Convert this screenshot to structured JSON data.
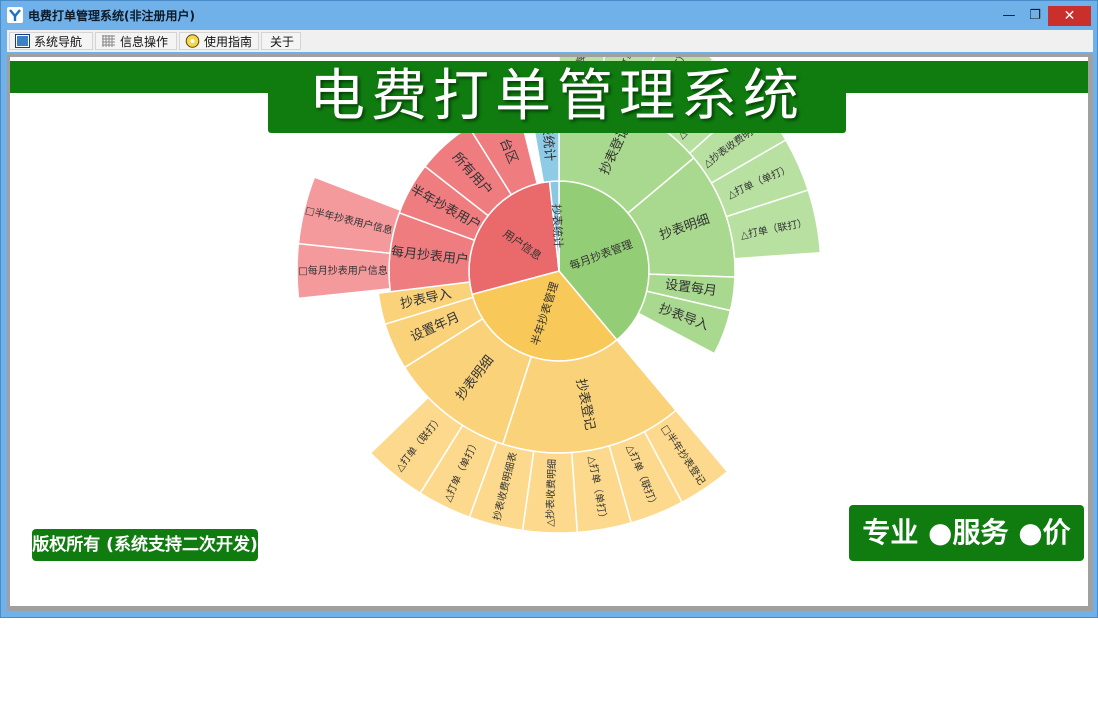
{
  "window": {
    "title": "电费打单管理系统(非注册用户)",
    "controls": {
      "minimize": "—",
      "maximize": "❐",
      "close": "✕"
    }
  },
  "menu": [
    {
      "label": "系统导航",
      "icon": "navigator-icon"
    },
    {
      "label": "信息操作",
      "icon": "grid-icon"
    },
    {
      "label": "使用指南",
      "icon": "guide-icon"
    },
    {
      "label": "关于",
      "icon": ""
    }
  ],
  "banner": {
    "title": "电费打单管理系统"
  },
  "footer": {
    "copyright": "版权所有 (系统支持二次开发)",
    "slogan": "专业 ●服务 ●价值"
  },
  "colors": {
    "green_brand": "#107c10",
    "green_segment": "#a3d88a",
    "red_segment": "#ee6b6e",
    "blue_segment": "#88c8e3",
    "yellow_segment": "#f7cf6a"
  },
  "sunburst": {
    "inner": [
      {
        "label": "每月抄表管理",
        "color": "#93cd75"
      },
      {
        "label": "半年抄表管理",
        "color": "#f8c859"
      },
      {
        "label": "用户信息",
        "color": "#ea6a6c"
      },
      {
        "label": "抄表统计",
        "color": "#88c8e3"
      }
    ],
    "middle": [
      {
        "label": "抄表登记",
        "color": "#a8d98e"
      },
      {
        "label": "抄表明细",
        "color": "#a8d98e"
      },
      {
        "label": "设置每月",
        "color": "#a8d98e"
      },
      {
        "label": "抄表导入",
        "color": "#a8d98e"
      },
      {
        "label": "抄表登记",
        "color": "#fad27a"
      },
      {
        "label": "抄表明细",
        "color": "#fad27a"
      },
      {
        "label": "设置年月",
        "color": "#fad27a"
      },
      {
        "label": "抄表导入",
        "color": "#fad27a"
      },
      {
        "label": "每月抄表用户",
        "color": "#ef7d80"
      },
      {
        "label": "半年抄表用户",
        "color": "#ef7d80"
      },
      {
        "label": "所有用户",
        "color": "#ef7d80"
      },
      {
        "label": "台区",
        "color": "#ef7d80"
      },
      {
        "label": "抄表统计",
        "color": "#8fcbe5"
      }
    ],
    "outer": [
      {
        "label": "□每月登",
        "color": "#b7e0a1"
      },
      {
        "label": "△打单",
        "color": "#b7e0a1"
      },
      {
        "label": "△打单（单打）",
        "color": "#b7e0a1"
      },
      {
        "label": "△抄表收费明细表",
        "color": "#b7e0a1"
      },
      {
        "label": "△抄表收费明细表",
        "color": "#b7e0a1"
      },
      {
        "label": "△打单（单打）",
        "color": "#b7e0a1"
      },
      {
        "label": "△打单（联打）",
        "color": "#b7e0a1"
      },
      {
        "label": "□半年抄表登记",
        "color": "#fcd98c"
      },
      {
        "label": "△打单（联打）",
        "color": "#fcd98c"
      },
      {
        "label": "△打单（单打）",
        "color": "#fcd98c"
      },
      {
        "label": "△抄表收费明细",
        "color": "#fcd98c"
      },
      {
        "label": "抄表收费明细表",
        "color": "#fcd98c"
      },
      {
        "label": "△打单（单打）",
        "color": "#fcd98c"
      },
      {
        "label": "△打单（联打）",
        "color": "#fcd98c"
      },
      {
        "label": "□每月抄表用户信息",
        "color": "#f49a9c"
      },
      {
        "label": "□半年抄表用户信息",
        "color": "#f49a9c"
      }
    ]
  }
}
